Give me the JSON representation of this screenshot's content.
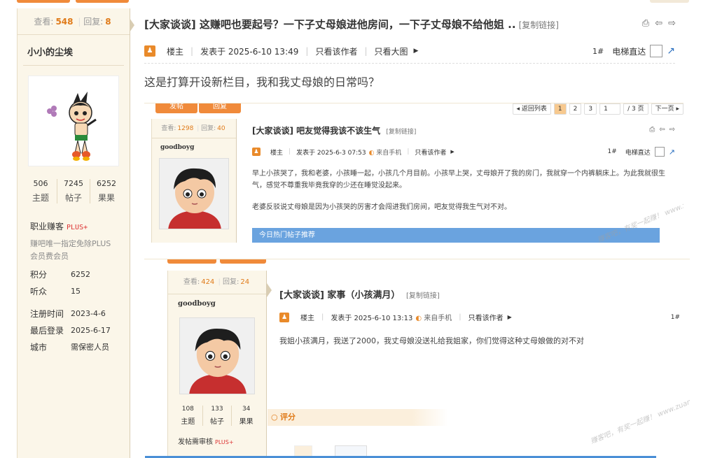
{
  "header": {
    "views_label": "查看:",
    "views": "548",
    "replies_label": "回复:",
    "replies": "8"
  },
  "thread": {
    "title": "[大家谈谈] 这赚吧也要起号？一下子丈母娘进他房间，一下子丈母娘不给他姐 ..",
    "copy_link": "[复制链接]"
  },
  "author": {
    "name": "小小的尘埃",
    "topics": "506",
    "topics_label": "主题",
    "posts": "7245",
    "posts_label": "帖子",
    "fruits": "6252",
    "fruits_label": "果果",
    "rank": "职业赚客",
    "plus": "PLUS+",
    "rank_desc": "赚吧唯一指定免除PLUS会员费会员",
    "points_label": "积分",
    "points": "6252",
    "listeners_label": "听众",
    "listeners": "15",
    "reg_label": "注册时间",
    "reg": "2023-4-6",
    "last_label": "最后登录",
    "last": "2025-6-17",
    "city_label": "城市",
    "city": "需保密人员"
  },
  "post": {
    "author_tag": "楼主",
    "posted_at": "发表于 2025-6-10 13:49",
    "only_author": "只看该作者",
    "big_image": "只看大图",
    "floor": "1#",
    "elevator": "电梯直达",
    "body": "这是打算开设新栏目，我和我丈母娘的日常吗？"
  },
  "shot1": {
    "btn1": "发帖",
    "btn2": "回复",
    "pager": [
      "◂ 返回列表",
      "1",
      "2",
      "3",
      "1",
      "/ 3 页",
      "下一页 ▸"
    ],
    "views_label": "查看:",
    "views": "1298",
    "replies_label": "回复:",
    "replies": "40",
    "username": "goodboyg",
    "title": "[大家谈谈] 吧友觉得我该不该生气",
    "copy_link": "[复制链接]",
    "author_tag": "楼主",
    "posted_at": "发表于 2025-6-3 07:53",
    "mobile": "来自手机",
    "only_author": "只看该作者",
    "floor": "1#",
    "elevator": "电梯直达",
    "para1": "早上小孩哭了，我和老婆，小孩睡一起，小孩几个月目前。小孩早上哭，丈母娘开了我的房门，我就穿一个内裤躺床上。为此我就很生气，感觉不尊重我毕竟我穿的少还在睡觉没起来。",
    "para2": "老婆反驳说丈母娘是因为小孩哭的厉害才会闯进我们房间，吧友觉得我生气对不对。",
    "hot": "今日热门帖子推荐"
  },
  "shot2": {
    "views_label": "查看:",
    "views": "424",
    "replies_label": "回复:",
    "replies": "24",
    "username": "goodboyg",
    "title": "[大家谈谈] 家事（小孩满月）",
    "copy_link": "[复制链接]",
    "author_tag": "楼主",
    "posted_at": "发表于 2025-6-10 13:13",
    "mobile": "来自手机",
    "only_author": "只看该作者",
    "floor": "1#",
    "body": "我姐小孩满月，我送了2000，我丈母娘没送礼给我姐家，你们觉得这种丈母娘做的对不对",
    "rate": "评分",
    "topics": "108",
    "topics_label": "主题",
    "posts": "133",
    "posts_label": "帖子",
    "fruits": "34",
    "fruits_label": "果果",
    "rank": "发帖需审核",
    "plus": "PLUS+"
  },
  "watermark": "赚客吧，有奖一起赚！ www.zuanke8.com",
  "colors": {
    "accent": "#f08a3a",
    "link_blue": "#2a6fc0",
    "sidebar_bg": "#fbf6e9"
  }
}
